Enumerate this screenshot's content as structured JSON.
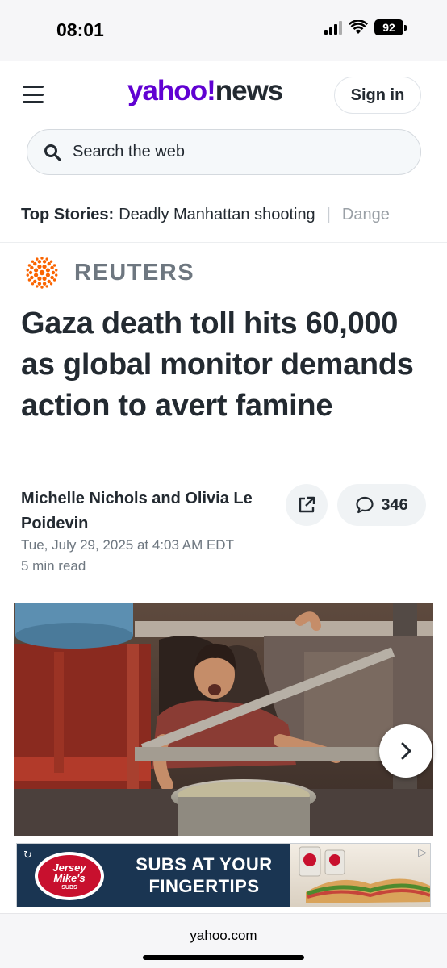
{
  "status_bar": {
    "time": "08:01",
    "battery": "92",
    "icons": [
      "cellular-signal-icon",
      "wifi-icon",
      "battery-icon"
    ]
  },
  "header": {
    "logo_brand": "yahoo!",
    "logo_section": "news",
    "sign_in_label": "Sign in",
    "search_placeholder": "Search the web",
    "top_stories_label": "Top Stories:",
    "top_stories": [
      "Deadly Manhattan shooting",
      "Dange"
    ]
  },
  "article": {
    "provider": "REUTERS",
    "headline": "Gaza death toll hits 60,000 as global monitor demands action to avert famine",
    "byline": "Michelle Nichols and Olivia Le Poidevin",
    "date": "Tue, July 29, 2025 at 4:03 AM EDT",
    "read_time": "5 min read",
    "comment_count": "346"
  },
  "ad": {
    "brand_logo": "Jersey Mike's",
    "brand_sub": "SUBS",
    "text_line1": "SUBS AT YOUR",
    "text_line2": "FINGERTIPS"
  },
  "browser": {
    "url": "yahoo.com"
  },
  "colors": {
    "yahoo_purple": "#6001d2",
    "reuters_orange": "#fa6400",
    "text_primary": "#232a31",
    "text_secondary": "#6e7780",
    "ad_background": "#1a3552"
  }
}
